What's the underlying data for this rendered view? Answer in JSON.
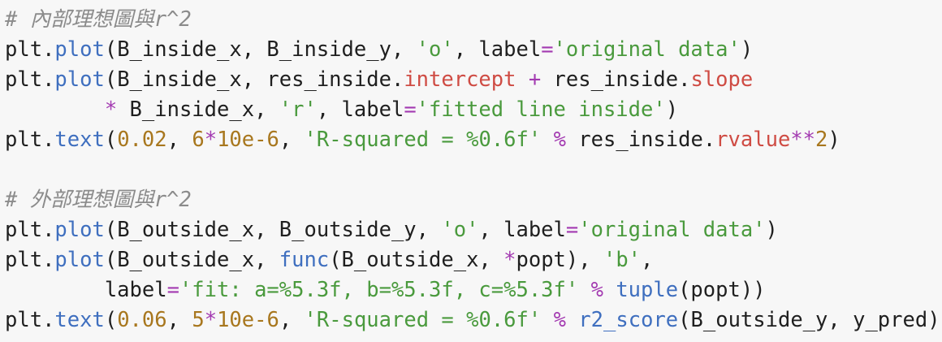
{
  "editor": {
    "colors": {
      "background": "#f7f7f7",
      "comment": "#8b8b8b",
      "identifier": "#1f1f1f",
      "method": "#3f6fbf",
      "attribute": "#cf4c44",
      "string": "#4a9a3d",
      "number": "#a8771e",
      "operator": "#a33ab1"
    },
    "lines": [
      [
        {
          "t": "# 內部理想圖與r^2",
          "k": "comment"
        }
      ],
      [
        {
          "t": "plt",
          "k": "ident"
        },
        {
          "t": ".",
          "k": "punct"
        },
        {
          "t": "plot",
          "k": "method"
        },
        {
          "t": "(B_inside_x, B_inside_y, ",
          "k": "punct"
        },
        {
          "t": "'o'",
          "k": "string"
        },
        {
          "t": ", label",
          "k": "punct"
        },
        {
          "t": "=",
          "k": "operator"
        },
        {
          "t": "'original data'",
          "k": "string"
        },
        {
          "t": ")",
          "k": "punct"
        }
      ],
      [
        {
          "t": "plt",
          "k": "ident"
        },
        {
          "t": ".",
          "k": "punct"
        },
        {
          "t": "plot",
          "k": "method"
        },
        {
          "t": "(B_inside_x, res_inside.",
          "k": "punct"
        },
        {
          "t": "intercept",
          "k": "attr"
        },
        {
          "t": " ",
          "k": "punct"
        },
        {
          "t": "+",
          "k": "operator"
        },
        {
          "t": " res_inside.",
          "k": "punct"
        },
        {
          "t": "slope",
          "k": "attr"
        }
      ],
      [
        {
          "t": "        ",
          "k": "punct"
        },
        {
          "t": "*",
          "k": "operator"
        },
        {
          "t": " B_inside_x, ",
          "k": "punct"
        },
        {
          "t": "'r'",
          "k": "string"
        },
        {
          "t": ", label",
          "k": "punct"
        },
        {
          "t": "=",
          "k": "operator"
        },
        {
          "t": "'fitted line inside'",
          "k": "string"
        },
        {
          "t": ")",
          "k": "punct"
        }
      ],
      [
        {
          "t": "plt",
          "k": "ident"
        },
        {
          "t": ".",
          "k": "punct"
        },
        {
          "t": "text",
          "k": "method"
        },
        {
          "t": "(",
          "k": "punct"
        },
        {
          "t": "0.02",
          "k": "number"
        },
        {
          "t": ", ",
          "k": "punct"
        },
        {
          "t": "6",
          "k": "number"
        },
        {
          "t": "*",
          "k": "operator"
        },
        {
          "t": "10e-6",
          "k": "number"
        },
        {
          "t": ", ",
          "k": "punct"
        },
        {
          "t": "'R-squared = %0.6f'",
          "k": "string"
        },
        {
          "t": " ",
          "k": "punct"
        },
        {
          "t": "%",
          "k": "operator"
        },
        {
          "t": " res_inside.",
          "k": "punct"
        },
        {
          "t": "rvalue",
          "k": "attr"
        },
        {
          "t": "**",
          "k": "operator"
        },
        {
          "t": "2",
          "k": "number"
        },
        {
          "t": ")",
          "k": "punct"
        }
      ],
      [],
      [
        {
          "t": "# 外部理想圖與r^2",
          "k": "comment"
        }
      ],
      [
        {
          "t": "plt",
          "k": "ident"
        },
        {
          "t": ".",
          "k": "punct"
        },
        {
          "t": "plot",
          "k": "method"
        },
        {
          "t": "(B_outside_x, B_outside_y, ",
          "k": "punct"
        },
        {
          "t": "'o'",
          "k": "string"
        },
        {
          "t": ", label",
          "k": "punct"
        },
        {
          "t": "=",
          "k": "operator"
        },
        {
          "t": "'original data'",
          "k": "string"
        },
        {
          "t": ")",
          "k": "punct"
        }
      ],
      [
        {
          "t": "plt",
          "k": "ident"
        },
        {
          "t": ".",
          "k": "punct"
        },
        {
          "t": "plot",
          "k": "method"
        },
        {
          "t": "(B_outside_x, ",
          "k": "punct"
        },
        {
          "t": "func",
          "k": "method"
        },
        {
          "t": "(B_outside_x, ",
          "k": "punct"
        },
        {
          "t": "*",
          "k": "operator"
        },
        {
          "t": "popt), ",
          "k": "punct"
        },
        {
          "t": "'b'",
          "k": "string"
        },
        {
          "t": ",",
          "k": "punct"
        }
      ],
      [
        {
          "t": "        label",
          "k": "punct"
        },
        {
          "t": "=",
          "k": "operator"
        },
        {
          "t": "'fit: a=%5.3f, b=%5.3f, c=%5.3f'",
          "k": "string"
        },
        {
          "t": " ",
          "k": "punct"
        },
        {
          "t": "%",
          "k": "operator"
        },
        {
          "t": " ",
          "k": "punct"
        },
        {
          "t": "tuple",
          "k": "method"
        },
        {
          "t": "(popt))",
          "k": "punct"
        }
      ],
      [
        {
          "t": "plt",
          "k": "ident"
        },
        {
          "t": ".",
          "k": "punct"
        },
        {
          "t": "text",
          "k": "method"
        },
        {
          "t": "(",
          "k": "punct"
        },
        {
          "t": "0.06",
          "k": "number"
        },
        {
          "t": ", ",
          "k": "punct"
        },
        {
          "t": "5",
          "k": "number"
        },
        {
          "t": "*",
          "k": "operator"
        },
        {
          "t": "10e-6",
          "k": "number"
        },
        {
          "t": ", ",
          "k": "punct"
        },
        {
          "t": "'R-squared = %0.6f'",
          "k": "string"
        },
        {
          "t": " ",
          "k": "punct"
        },
        {
          "t": "%",
          "k": "operator"
        },
        {
          "t": " ",
          "k": "punct"
        },
        {
          "t": "r2_score",
          "k": "method"
        },
        {
          "t": "(B_outside_y, y_pred))",
          "k": "punct"
        }
      ]
    ]
  }
}
